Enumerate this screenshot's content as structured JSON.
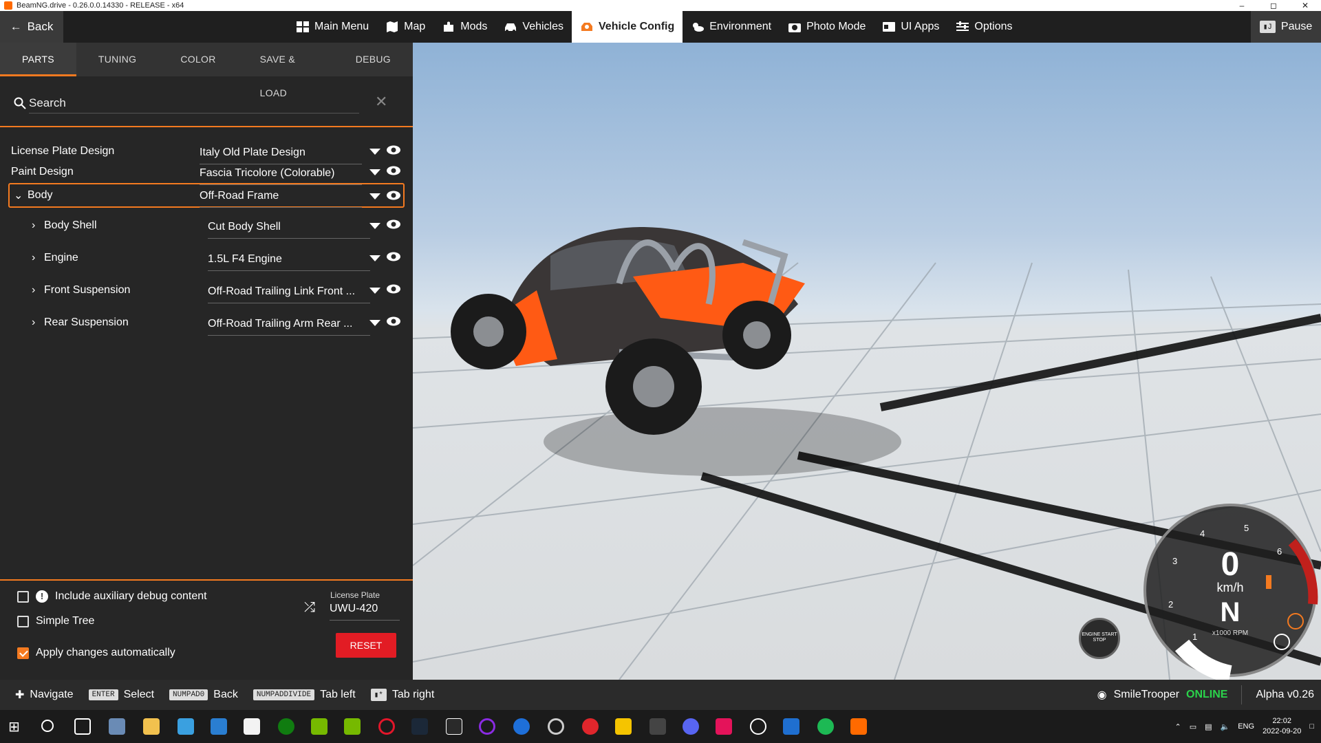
{
  "window": {
    "title": "BeamNG.drive - 0.26.0.0.14330 - RELEASE - x64"
  },
  "topbar": {
    "back_label": "Back",
    "pause_label": "Pause",
    "nav": [
      {
        "label": "Main Menu",
        "icon": "main-menu-icon"
      },
      {
        "label": "Map",
        "icon": "map-icon"
      },
      {
        "label": "Mods",
        "icon": "mods-icon"
      },
      {
        "label": "Vehicles",
        "icon": "car-icon"
      },
      {
        "label": "Vehicle Config",
        "icon": "vehicle-config-icon",
        "active": true
      },
      {
        "label": "Environment",
        "icon": "weather-icon"
      },
      {
        "label": "Photo Mode",
        "icon": "camera-icon"
      },
      {
        "label": "UI Apps",
        "icon": "ui-apps-icon"
      },
      {
        "label": "Options",
        "icon": "sliders-icon"
      }
    ]
  },
  "panel": {
    "tabs": [
      "PARTS",
      "TUNING",
      "COLOR",
      "SAVE & LOAD",
      "DEBUG"
    ],
    "search_placeholder": "Search",
    "parts": [
      {
        "label": "License Plate Design",
        "value": "Italy Old Plate Design"
      },
      {
        "label": "Paint Design",
        "value": "Fascia Tricolore (Colorable)"
      },
      {
        "label": "Body",
        "value": "Off-Road Frame"
      },
      {
        "label": "Body Shell",
        "value": "Cut Body Shell"
      },
      {
        "label": "Engine",
        "value": "1.5L F4 Engine"
      },
      {
        "label": "Front Suspension",
        "value": "Off-Road Trailing Link Front ..."
      },
      {
        "label": "Rear Suspension",
        "value": "Off-Road Trailing Arm Rear ..."
      }
    ],
    "options": {
      "debug_label": "Include auxiliary debug content",
      "debug_checked": false,
      "simple_tree_label": "Simple Tree",
      "simple_tree_checked": false,
      "auto_apply_label": "Apply changes automatically",
      "auto_apply_checked": true
    },
    "license_plate": {
      "label": "License Plate",
      "value": "UWU-420"
    },
    "reset_label": "RESET"
  },
  "statusbar": {
    "hints": [
      {
        "key": "",
        "label": "Navigate"
      },
      {
        "key": "ENTER",
        "label": "Select"
      },
      {
        "key": "NUMPAD0",
        "label": "Back"
      },
      {
        "key": "NUMPADDIVIDE",
        "label": "Tab left"
      },
      {
        "key": "",
        "label": "Tab right"
      }
    ],
    "user": "SmileTrooper",
    "online": "ONLINE",
    "version": "Alpha v0.26"
  },
  "gauge": {
    "speed": "0",
    "unit": "km/h",
    "gear": "N",
    "rpm_label": "x1000 RPM",
    "ticks": [
      "1",
      "2",
      "3",
      "4",
      "5",
      "6"
    ],
    "engine_button": "ENGINE START STOP"
  },
  "taskbar": {
    "lang": "ENG",
    "time": "22:02",
    "date": "2022-09-20"
  },
  "colors": {
    "accent": "#f47a20",
    "reset": "#e21c24",
    "online": "#2bd34b"
  }
}
